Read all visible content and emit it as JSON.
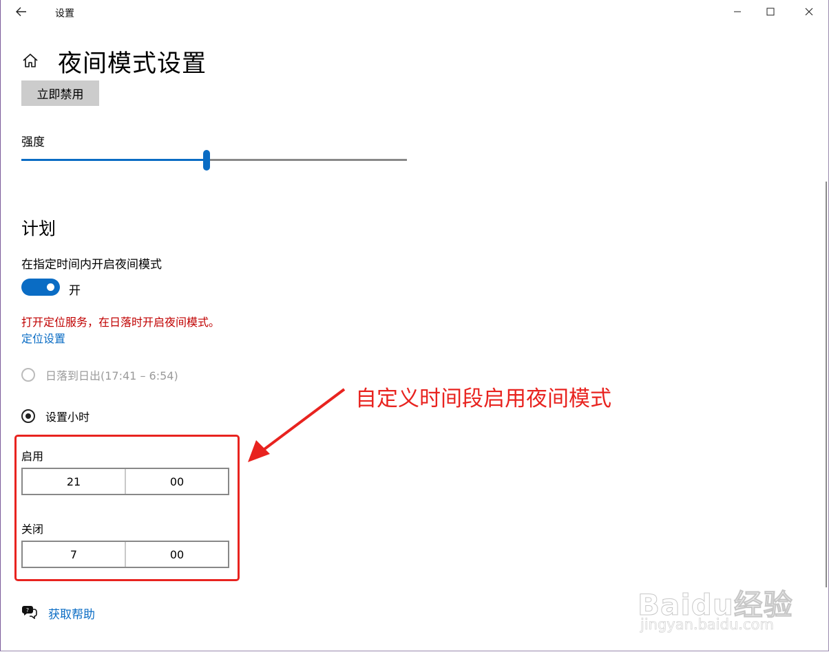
{
  "window": {
    "title": "设置"
  },
  "header": {
    "page_title": "夜间模式设置",
    "disable_now_label": "立即禁用"
  },
  "strength": {
    "label": "强度",
    "value_percent": 48
  },
  "schedule": {
    "section_title": "计划",
    "schedule_label": "在指定时间内开启夜间模式",
    "toggle_on": true,
    "toggle_state_label": "开",
    "location_warning": "打开定位服务，在日落时开启夜间模式。",
    "location_link": "定位设置",
    "radio_sunset_label": "日落到日出(17:41 – 6:54)",
    "radio_sunset_enabled": false,
    "radio_hours_label": "设置小时",
    "radio_hours_checked": true,
    "on_label": "启用",
    "on_time": {
      "hour": "21",
      "minute": "00"
    },
    "off_label": "关闭",
    "off_time": {
      "hour": "7",
      "minute": "00"
    }
  },
  "annotation": {
    "text": "自定义时间段启用夜间模式",
    "color": "#e8231f"
  },
  "help": {
    "link_label": "获取帮助"
  },
  "watermark": {
    "brand": "Baidu经验",
    "url": "jingyan.baidu.com"
  },
  "colors": {
    "accent": "#0a6cc4",
    "warning": "#c00000",
    "button_bg": "#cccccc"
  },
  "icons": [
    "back-arrow-icon",
    "minimize-icon",
    "maximize-icon",
    "close-icon",
    "home-icon",
    "help-chat-icon"
  ]
}
